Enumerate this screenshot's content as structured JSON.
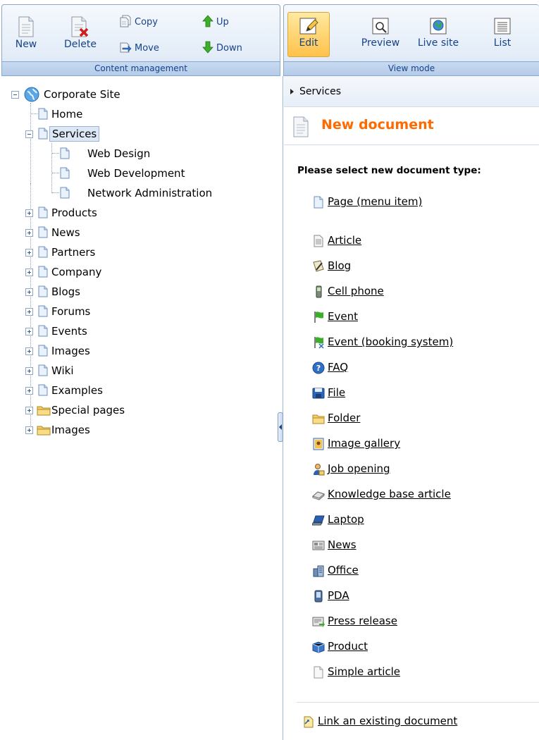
{
  "toolbar": {
    "content_management": {
      "caption": "Content management",
      "new_label": "New",
      "delete_label": "Delete",
      "copy_label": "Copy",
      "move_label": "Move",
      "up_label": "Up",
      "down_label": "Down"
    },
    "view_mode": {
      "caption": "View mode",
      "edit_label": "Edit",
      "preview_label": "Preview",
      "live_site_label": "Live site",
      "list_label": "List",
      "active": "Edit"
    }
  },
  "tree": {
    "root": "Corporate Site",
    "selected": "Services",
    "nodes": [
      {
        "label": "Home",
        "icon": "document-icon"
      },
      {
        "label": "Services",
        "icon": "document-icon",
        "expanded": true,
        "children": [
          {
            "label": "Web Design",
            "icon": "document-icon"
          },
          {
            "label": "Web Development",
            "icon": "document-icon"
          },
          {
            "label": "Network Administration",
            "icon": "document-icon"
          }
        ]
      },
      {
        "label": "Products",
        "icon": "document-icon"
      },
      {
        "label": "News",
        "icon": "document-icon"
      },
      {
        "label": "Partners",
        "icon": "document-icon"
      },
      {
        "label": "Company",
        "icon": "document-icon"
      },
      {
        "label": "Blogs",
        "icon": "document-icon"
      },
      {
        "label": "Forums",
        "icon": "document-icon"
      },
      {
        "label": "Events",
        "icon": "document-icon"
      },
      {
        "label": "Images",
        "icon": "document-icon"
      },
      {
        "label": "Wiki",
        "icon": "document-icon"
      },
      {
        "label": "Examples",
        "icon": "document-icon"
      },
      {
        "label": "Special pages",
        "icon": "folder-icon"
      },
      {
        "label": "Images",
        "icon": "folder-icon"
      }
    ]
  },
  "breadcrumb": "Services",
  "page": {
    "title": "New document",
    "prompt": "Please select new document type:"
  },
  "document_types": [
    {
      "label": "Page (menu item)",
      "icon": "page-icon"
    },
    {
      "label": "Article",
      "icon": "article-icon"
    },
    {
      "label": "Blog",
      "icon": "blog-icon"
    },
    {
      "label": "Cell phone",
      "icon": "cell-phone-icon"
    },
    {
      "label": "Event",
      "icon": "event-flag-icon"
    },
    {
      "label": "Event (booking system)",
      "icon": "event-booking-icon"
    },
    {
      "label": "FAQ",
      "icon": "faq-icon"
    },
    {
      "label": "File",
      "icon": "file-icon"
    },
    {
      "label": "Folder",
      "icon": "folder-icon"
    },
    {
      "label": "Image gallery",
      "icon": "image-gallery-icon"
    },
    {
      "label": "Job opening",
      "icon": "job-opening-icon"
    },
    {
      "label": "Knowledge base article",
      "icon": "knowledge-base-icon"
    },
    {
      "label": "Laptop",
      "icon": "laptop-icon"
    },
    {
      "label": "News",
      "icon": "news-icon"
    },
    {
      "label": "Office",
      "icon": "office-icon"
    },
    {
      "label": "PDA",
      "icon": "pda-icon"
    },
    {
      "label": "Press release",
      "icon": "press-release-icon"
    },
    {
      "label": "Product",
      "icon": "product-icon"
    },
    {
      "label": "Simple article",
      "icon": "simple-article-icon"
    }
  ],
  "link_existing": "Link an existing document",
  "colors": {
    "title_orange": "#ff6a00",
    "toolbar_text": "#15428b",
    "active_button": "#ffc24a"
  }
}
